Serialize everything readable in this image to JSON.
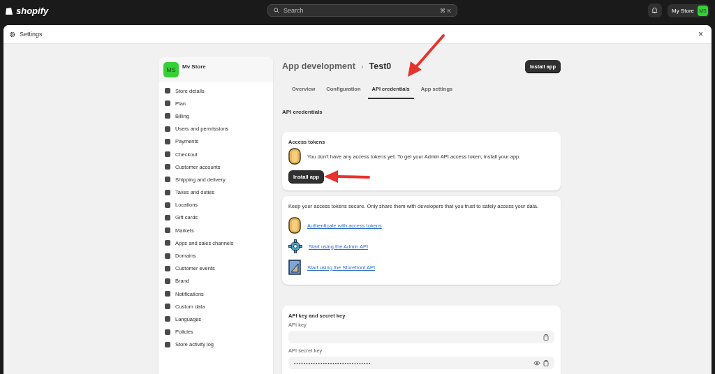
{
  "topbar": {
    "logo": "shopify",
    "search": {
      "placeholder": "Search",
      "shortcut": "⌘ K"
    },
    "store": {
      "name": "My Store",
      "initials": "MS"
    }
  },
  "window": {
    "title": "Settings",
    "close": "×"
  },
  "sidebar": {
    "store": {
      "initials": "MS",
      "name": "Mv Store"
    },
    "items": [
      {
        "label": "Store details"
      },
      {
        "label": "Plan"
      },
      {
        "label": "Billing"
      },
      {
        "label": "Users and permissions"
      },
      {
        "label": "Payments"
      },
      {
        "label": "Checkout"
      },
      {
        "label": "Customer accounts"
      },
      {
        "label": "Shipping and delivery"
      },
      {
        "label": "Taxes and duties"
      },
      {
        "label": "Locations"
      },
      {
        "label": "Gift cards"
      },
      {
        "label": "Markets"
      },
      {
        "label": "Apps and sales channels"
      },
      {
        "label": "Domains"
      },
      {
        "label": "Customer events"
      },
      {
        "label": "Brand"
      },
      {
        "label": "Notifications"
      },
      {
        "label": "Custom data"
      },
      {
        "label": "Languages"
      },
      {
        "label": "Policies"
      },
      {
        "label": "Store activity log"
      }
    ]
  },
  "page": {
    "breadcrumb": "App development",
    "separator": "›",
    "title": "Test0",
    "action": "Install app"
  },
  "tabs": [
    {
      "label": "Overview",
      "selected": false
    },
    {
      "label": "Configuration",
      "selected": false
    },
    {
      "label": "API credentials",
      "selected": true
    },
    {
      "label": "App settings",
      "selected": false
    }
  ],
  "section_title": "API credentials",
  "access_tokens": {
    "title": "Access tokens",
    "message": "You don't have any access tokens yet. To get your Admin API access token, install your app.",
    "button": "Install app"
  },
  "resources": {
    "note": "Keep your access tokens secure. Only share them with developers that you trust to safely access your data.",
    "links": [
      {
        "kind": "coin",
        "label": "Authenticate with access tokens"
      },
      {
        "kind": "gear",
        "label": "Start using the Admin API"
      },
      {
        "kind": "document",
        "label": "Start using the Storefront API"
      }
    ]
  },
  "keys": {
    "title": "API key and secret key",
    "fields": [
      {
        "label": "API key",
        "kind": "plain"
      },
      {
        "label": "API secret key",
        "kind": "secret",
        "value": "••••••••••••••••••••••••••••••••"
      }
    ]
  }
}
